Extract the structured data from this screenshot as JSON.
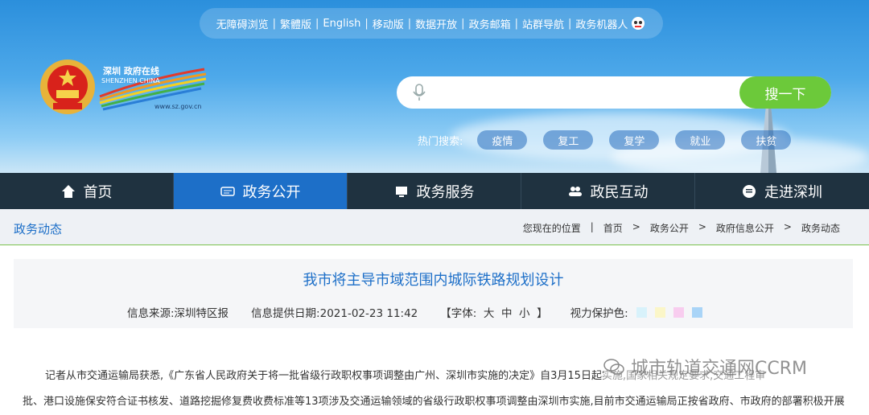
{
  "top_links": [
    "无障碍浏览",
    "繁體版",
    "English",
    "移动版",
    "数据开放",
    "政务邮箱",
    "站群导航",
    "政务机器人"
  ],
  "logo": {
    "text_cn": "深圳 政府在线",
    "text_en": "SHENZHEN CHINA",
    "url": "www.sz.gov.cn"
  },
  "search": {
    "placeholder": "",
    "button": "搜一下"
  },
  "hot_search": {
    "label": "热门搜索:",
    "keywords": [
      "疫情",
      "复工",
      "复学",
      "就业",
      "扶贫"
    ]
  },
  "nav": [
    {
      "label": "首页",
      "icon": "home-icon"
    },
    {
      "label": "政务公开",
      "icon": "news-icon"
    },
    {
      "label": "政务服务",
      "icon": "monitor-icon"
    },
    {
      "label": "政民互动",
      "icon": "people-icon"
    },
    {
      "label": "走进深圳",
      "icon": "chat-icon"
    }
  ],
  "nav_active": "政务公开",
  "section_title": "政务动态",
  "breadcrumb": {
    "label": "您现在的位置",
    "items": [
      "首页",
      "政务公开",
      "政府信息公开",
      "政务动态"
    ]
  },
  "article": {
    "title": "我市将主导市域范围内城际铁路规划设计",
    "source": "信息来源:深圳特区报",
    "date": "信息提供日期:2021-02-23 11:42",
    "font": "【字体:  大  中  小  】",
    "eye_label": "视力保护色:",
    "eye_colors": [
      "#d8f2fb",
      "#fbf6c8",
      "#f8cdef",
      "#a9d4f7"
    ],
    "para1": "记者从市交通运输局获悉,《广东省人民政府关于将一批省级行政职权事项调整由广州、深圳市实施的决定》自3月15日起实施,国家相关规定要求,交通工程审",
    "para2": "批、港口设施保安符合证书核发、道路挖掘修复费收费标准等13项涉及交通运输领域的省级行政职权事项调整由深圳市实施,目前市交通运输局正按省政府、市政府的部署积极开展"
  },
  "watermark": "城市轨道交通网CCRM",
  "colors": {
    "nav_bg": "#1f3240",
    "nav_active": "#1d6fc8",
    "search_btn": "#6cc93a",
    "accent": "#1d6fc8"
  }
}
